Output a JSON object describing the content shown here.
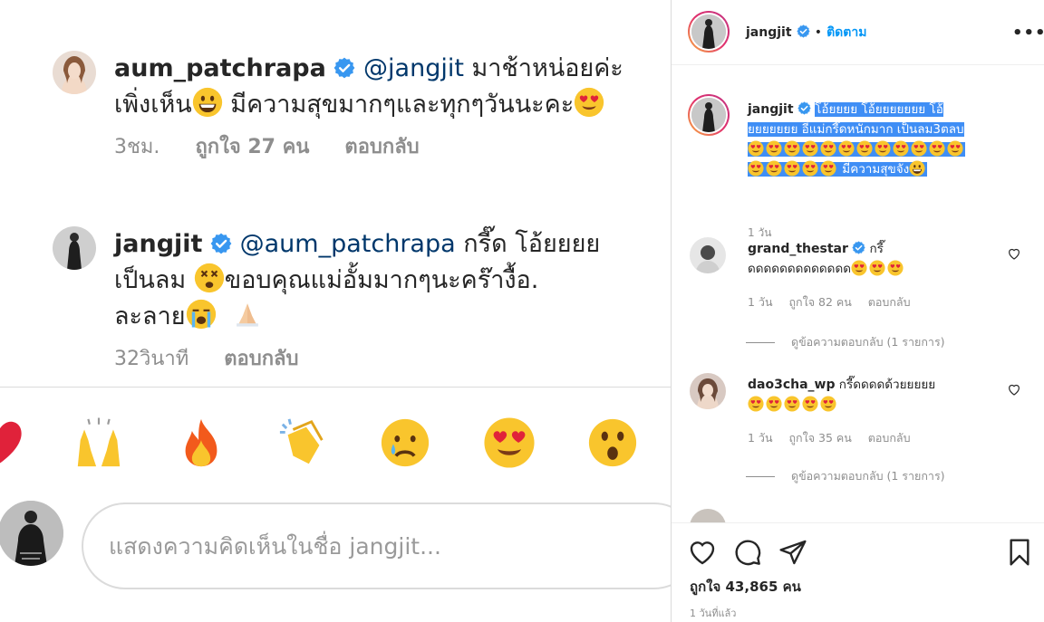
{
  "left": {
    "comment1": {
      "username": "aum_patchrapa",
      "mention": "@jangjit",
      "text_line1": " มาช้าหน่อยค่ะ",
      "text_line2": "เพิ่งเห็น",
      "text_line2b": " มีความสุขมากๆและทุกๆวันนะคะ",
      "time": "3ชม.",
      "likes": "ถูกใจ 27 คน",
      "reply": "ตอบกลับ"
    },
    "comment2": {
      "username": "jangjit",
      "mention": "@aum_patchrapa",
      "text_line1": " กรี๊ด โอ้ยยยย",
      "text_line2a": "เป็นลม ",
      "text_line2b": "ขอบคุณแม่อั้มมากๆนะคร๊างื้อ.",
      "text_line3": "ละลาย",
      "time": "32วินาที",
      "reply": "ตอบกลับ"
    },
    "emoji_bar": [
      "red-heart",
      "raising-hands",
      "fire",
      "clapping-hands",
      "crying-face",
      "heart-eyes",
      "surprised-face"
    ],
    "comment_input": {
      "placeholder": "แสดงความคิดเห็นในชื่อ jangjit..."
    }
  },
  "right": {
    "header": {
      "username": "jangjit",
      "dot": "•",
      "follow": "ติดตาม",
      "more": "•••"
    },
    "caption": {
      "username": "jangjit",
      "line1": "โอ้ยยยย โอ้ยยยยยยย โอ้",
      "line2": "ยยยยยยย อีแม่กรี๊ดหนักมาก เป็นลม3ตลบ",
      "line4_text": "มีความสุขจัง",
      "time": "1 วัน"
    },
    "comments": [
      {
        "username": "grand_thestar",
        "text_line1": " กรี๊",
        "text_line2": "ดดดดดดดดดดดดด",
        "time": "1 วัน",
        "likes": "ถูกใจ 82 คน",
        "reply": "ตอบกลับ",
        "view_replies": "ดูข้อความตอบกลับ (1 รายการ)"
      },
      {
        "username": "dao3cha_wp",
        "text_line1": " กรี๊ดดดดด้วยยยยย",
        "time": "1 วัน",
        "likes": "ถูกใจ 35 คน",
        "reply": "ตอบกลับ",
        "view_replies": "ดูข้อความตอบกลับ (1 รายการ)"
      }
    ],
    "likes_total": "ถูกใจ 43,865 คน",
    "posted_ago": "1 วันที่แล้ว"
  },
  "colors": {
    "link": "#00376b",
    "follow": "#0095f6",
    "verified": "#3897f0",
    "highlight": "#3f8ef5",
    "muted": "#8e8e8e"
  }
}
